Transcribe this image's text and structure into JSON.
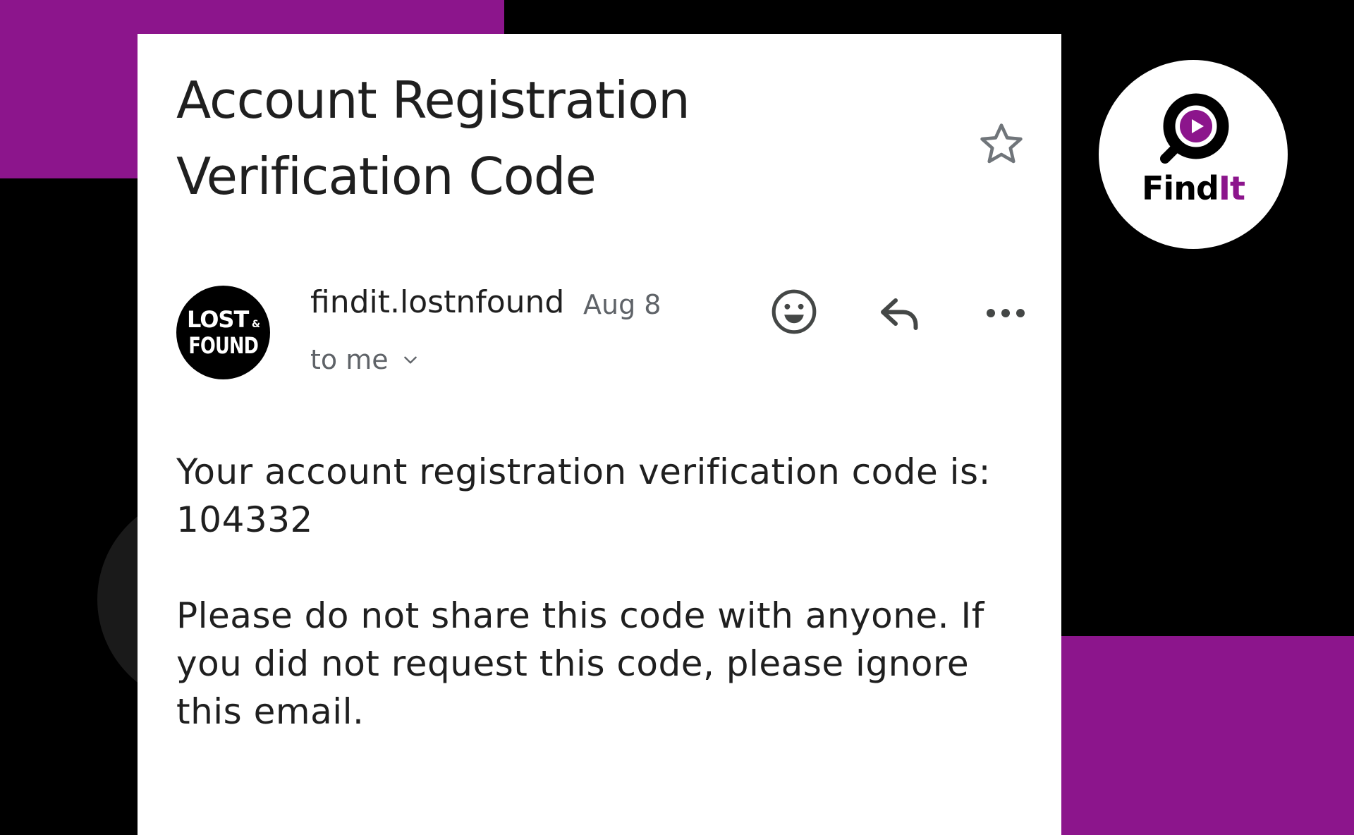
{
  "email": {
    "subject": "Account Registration Verification Code",
    "sender": "findit.lostnfound",
    "date": "Aug 8",
    "recipient": "to me",
    "avatar": {
      "line1": "LOST",
      "amp": "&",
      "line2": "FOUND"
    },
    "body_line1": "Your account registration verification code is:",
    "code": "104332",
    "body_line2": "Please do not share this code with anyone. If you did not request this code, please ignore this email."
  },
  "actions": {
    "star_icon": "star-outline-icon",
    "emoji_icon": "emoji-reaction-icon",
    "reply_icon": "reply-icon",
    "more_icon": "more-horizontal-icon",
    "expand_icon": "chevron-down-icon"
  },
  "brand": {
    "name_part1": "Find",
    "name_part2": "It",
    "accent_color": "#8c158c"
  }
}
